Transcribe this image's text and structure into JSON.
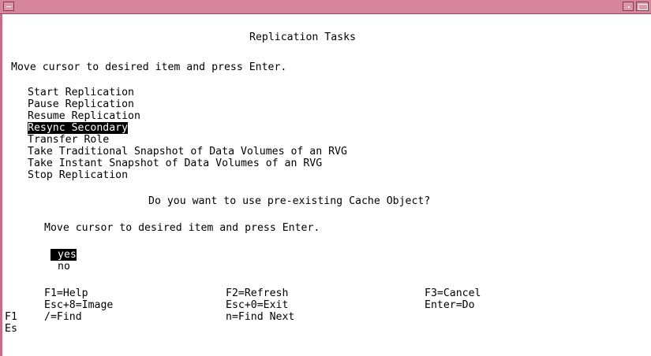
{
  "window": {
    "menu_icon": "window-menu-icon",
    "minimize_icon": "minimize-icon",
    "maximize_icon": "maximize-icon"
  },
  "screen": {
    "title": "Replication Tasks",
    "instruction": "Move cursor to desired item and press Enter.",
    "menu_items": [
      "Start Replication",
      "Pause Replication",
      "Resume Replication",
      "Resync Secondary",
      "Transfer Role",
      "Take Traditional Snapshot of Data Volumes of an RVG",
      "Take Instant Snapshot of Data Volumes of an RVG",
      "Stop Replication"
    ],
    "selected_menu_item": "Resync Secondary"
  },
  "dialog": {
    "question": "Do you want to use pre-existing Cache Object?",
    "instruction": "Move cursor to desired item and press Enter.",
    "options": [
      "yes",
      "no"
    ],
    "selected_option": "yes"
  },
  "function_keys": {
    "row1": [
      "F1=Help",
      "F2=Refresh",
      "F3=Cancel"
    ],
    "row2": [
      "Esc+8=Image",
      "Esc+0=Exit",
      "Enter=Do"
    ],
    "row3": [
      "/=Find",
      "n=Find Next"
    ]
  },
  "background_keys": {
    "f1": "F1",
    "es": "Es"
  }
}
